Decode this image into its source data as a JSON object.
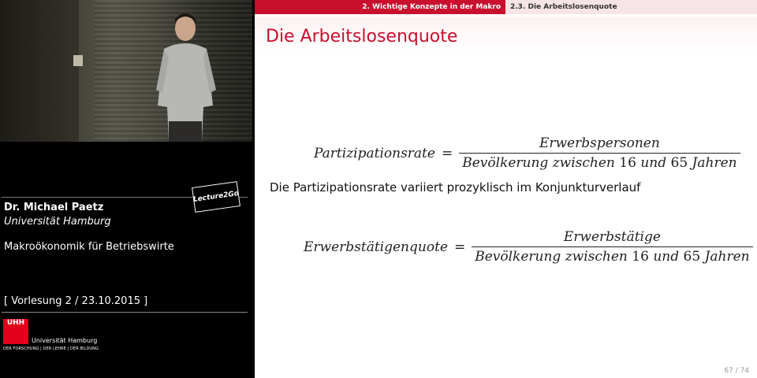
{
  "lecturer": {
    "name": "Dr. Michael Paetz",
    "university": "Universität Hamburg",
    "course": "Makroökonomik für Betriebswirte",
    "lecture": "[ Vorlesung 2 / 23.10.2015 ]",
    "badge": "Lecture2Go"
  },
  "logo": {
    "mark": "UHH",
    "name": "Universität Hamburg",
    "slogan": "DER FORSCHUNG | DER LEHRE | DER BILDUNG",
    "color": "#e2001a"
  },
  "slide": {
    "nav_section": "2. Wichtige Konzepte in der Makro",
    "nav_subsection": "2.3. Die Arbeitslosenquote",
    "title": "Die Arbeitslosenquote",
    "formula1": {
      "lhs": "Partizipationsrate",
      "eq": "=",
      "numerator": "Erwerbspersonen",
      "den_prefix": "Bevölkerung zwischen",
      "den_num1": "16",
      "den_mid": "und",
      "den_num2": "65",
      "den_suffix": "Jahren"
    },
    "text": "Die Partizipationsrate variiert prozyklisch im Konjunkturverlauf",
    "formula2": {
      "lhs": "Erwerbstätigenquote",
      "eq": "=",
      "numerator": "Erwerbstätige",
      "den_prefix": "Bevölkerung zwischen",
      "den_num1": "16",
      "den_mid": "und",
      "den_num2": "65",
      "den_suffix": "Jahren"
    },
    "page": "67 / 74",
    "accent": "#c8102e"
  }
}
